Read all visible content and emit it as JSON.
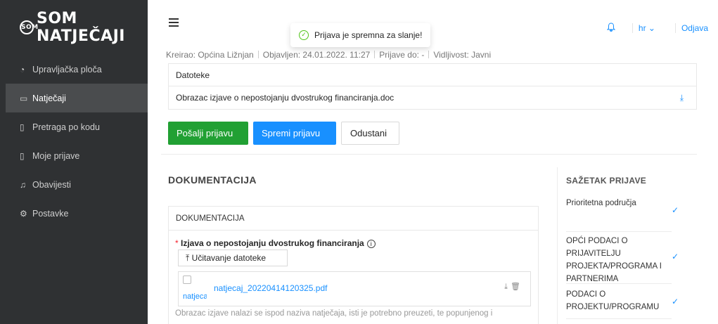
{
  "app": {
    "logo_text": "SOM NATJEČAJI",
    "logo_mark": "SOM"
  },
  "sidebar": {
    "items": [
      {
        "label": "Upravljačka ploča",
        "icon": "dashboard-icon"
      },
      {
        "label": "Natječaji",
        "icon": "folder-open-icon",
        "active": true
      },
      {
        "label": "Pretraga po kodu",
        "icon": "search-doc-icon"
      },
      {
        "label": "Moje prijave",
        "icon": "document-icon"
      },
      {
        "label": "Obavijesti",
        "icon": "bell-icon"
      },
      {
        "label": "Postavke",
        "icon": "gear-icon"
      }
    ]
  },
  "header": {
    "language": "hr",
    "logout_label": "Odjava"
  },
  "toast": {
    "message": "Prijava je spremna za slanje!"
  },
  "meta": {
    "creator": "Kreirao: Općina Ližnjan",
    "published": "Objavljen: 24.01.2022. 11:27",
    "deadline": "Prijave do: -",
    "visibility": "Vidljivost: Javni"
  },
  "files": {
    "header": "Datoteke",
    "items": [
      "Obrazac izjave o nepostojanju dvostrukog financiranja.doc"
    ]
  },
  "actions": {
    "send_label": "Pošalji prijavu",
    "save_label": "Spremi prijavu",
    "cancel_label": "Odustani"
  },
  "documentation": {
    "section_title": "DOKUMENTACIJA",
    "card_title": "DOKUMENTACIJA",
    "required_label": "Izjava o nepostojanju dvostrukog financiranja",
    "upload_label": "Učitavanje datoteke",
    "uploaded_file": "natjecaj_20220414120325.pdf",
    "thumb_caption": "natjecaj",
    "help_text": "Obrazac izjave nalazi se ispod naziva natječaja, isti je potrebno preuzeti, te popunjenog i"
  },
  "summary": {
    "title": "SAŽETAK PRIJAVE",
    "items": [
      {
        "label": "Prioritetna područja",
        "done": true
      },
      {
        "label": "OPĆI PODACI O PRIJAVITELJU PROJEKTA/PROGRAMA I PARTNERIMA",
        "done": true
      },
      {
        "label": "PODACI O PROJEKTU/PROGRAMU",
        "done": true
      }
    ]
  },
  "colors": {
    "sidebar_bg": "#2f3133",
    "primary": "#1890ff",
    "success": "#21a033",
    "danger": "#f5222d"
  }
}
